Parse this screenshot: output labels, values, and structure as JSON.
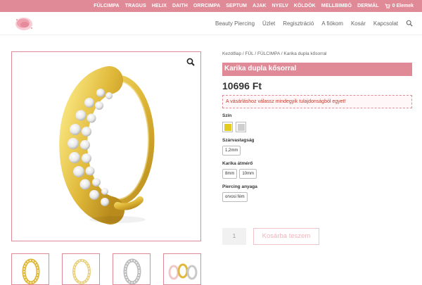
{
  "topnav": {
    "items": [
      "FÜLCIMPA",
      "TRAGUS",
      "HELIX",
      "DAITH",
      "ORRCIMPA",
      "SEPTUM",
      "AJAK",
      "NYELV",
      "KÖLDÖK",
      "MELLBIMBÓ",
      "DERMÁL"
    ],
    "cart_label": "0 Elemek"
  },
  "mainnav": {
    "items": [
      "Beauty Piercing",
      "Üzlet",
      "Regisztráció",
      "A fiókom",
      "Kosár",
      "Kapcsolat"
    ]
  },
  "product": {
    "breadcrumb": "Kezdőlap / FÜL / FÜLCIMPA / Karika dupla kősorral",
    "title": "Karika dupla kősorral",
    "price": "10696 Ft",
    "alert": "A vásárláshoz válassz mindegyik tulajdonságból egyet!",
    "attributes": {
      "color_label": "Szín",
      "color_options": [
        {
          "name": "gold",
          "hex": "#e3cc1f"
        },
        {
          "name": "silver",
          "hex": "#cfcfcf"
        }
      ],
      "thickness_label": "Szárvastagság",
      "thickness_options": [
        "1,2mm"
      ],
      "diameter_label": "Karika átmérő",
      "diameter_options": [
        "8mm",
        "10mm"
      ],
      "material_label": "Piercing anyaga",
      "material_options": [
        "orvosi fém"
      ]
    },
    "quantity": "1",
    "add_to_cart_label": "Kosárba teszem"
  },
  "colors": {
    "brand_pink": "#e08a97",
    "gold": "#e3cc1f",
    "silver": "#cfcfcf"
  }
}
